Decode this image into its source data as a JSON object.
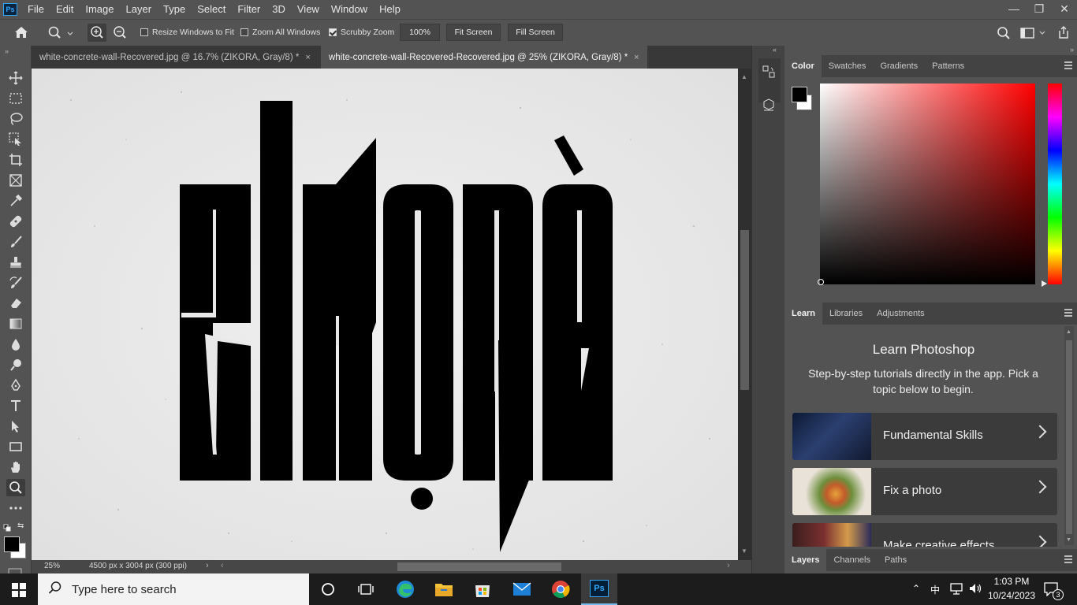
{
  "app": {
    "logo": "Ps"
  },
  "menu": [
    "File",
    "Edit",
    "Image",
    "Layer",
    "Type",
    "Select",
    "Filter",
    "3D",
    "View",
    "Window",
    "Help"
  ],
  "window_controls": {
    "minimize": "—",
    "restore": "❐",
    "close": "✕"
  },
  "options": {
    "resize_windows": "Resize Windows to Fit",
    "zoom_all": "Zoom All Windows",
    "scrubby_zoom": "Scrubby Zoom",
    "zoom_value": "100%",
    "fit_screen": "Fit Screen",
    "fill_screen": "Fill Screen"
  },
  "tabs": [
    {
      "label": "white-concrete-wall-Recovered.jpg @ 16.7% (ZIKORA, Gray/8) *",
      "close": "×"
    },
    {
      "label": "white-concrete-wall-Recovered-Recovered.jpg @ 25% (ZIKORA, Gray/8) *",
      "close": "×"
    }
  ],
  "status": {
    "zoom": "25%",
    "size": "4500 px x 3004 px (300 ppi)"
  },
  "color_panel": {
    "tabs": [
      "Color",
      "Swatches",
      "Gradients",
      "Patterns"
    ]
  },
  "learn_panel": {
    "tabs": [
      "Learn",
      "Libraries",
      "Adjustments"
    ],
    "title": "Learn Photoshop",
    "description": "Step-by-step tutorials directly in the app. Pick a topic below to begin.",
    "items": [
      {
        "label": "Fundamental Skills"
      },
      {
        "label": "Fix a photo"
      },
      {
        "label": "Make creative effects"
      }
    ]
  },
  "layers_panel": {
    "tabs": [
      "Layers",
      "Channels",
      "Paths"
    ]
  },
  "taskbar": {
    "search_placeholder": "Type here to search",
    "time": "1:03 PM",
    "date": "10/24/2023",
    "notification_count": "3"
  },
  "colors": {
    "accent": "#31a8ff",
    "foreground": "#000000",
    "background": "#ffffff"
  }
}
